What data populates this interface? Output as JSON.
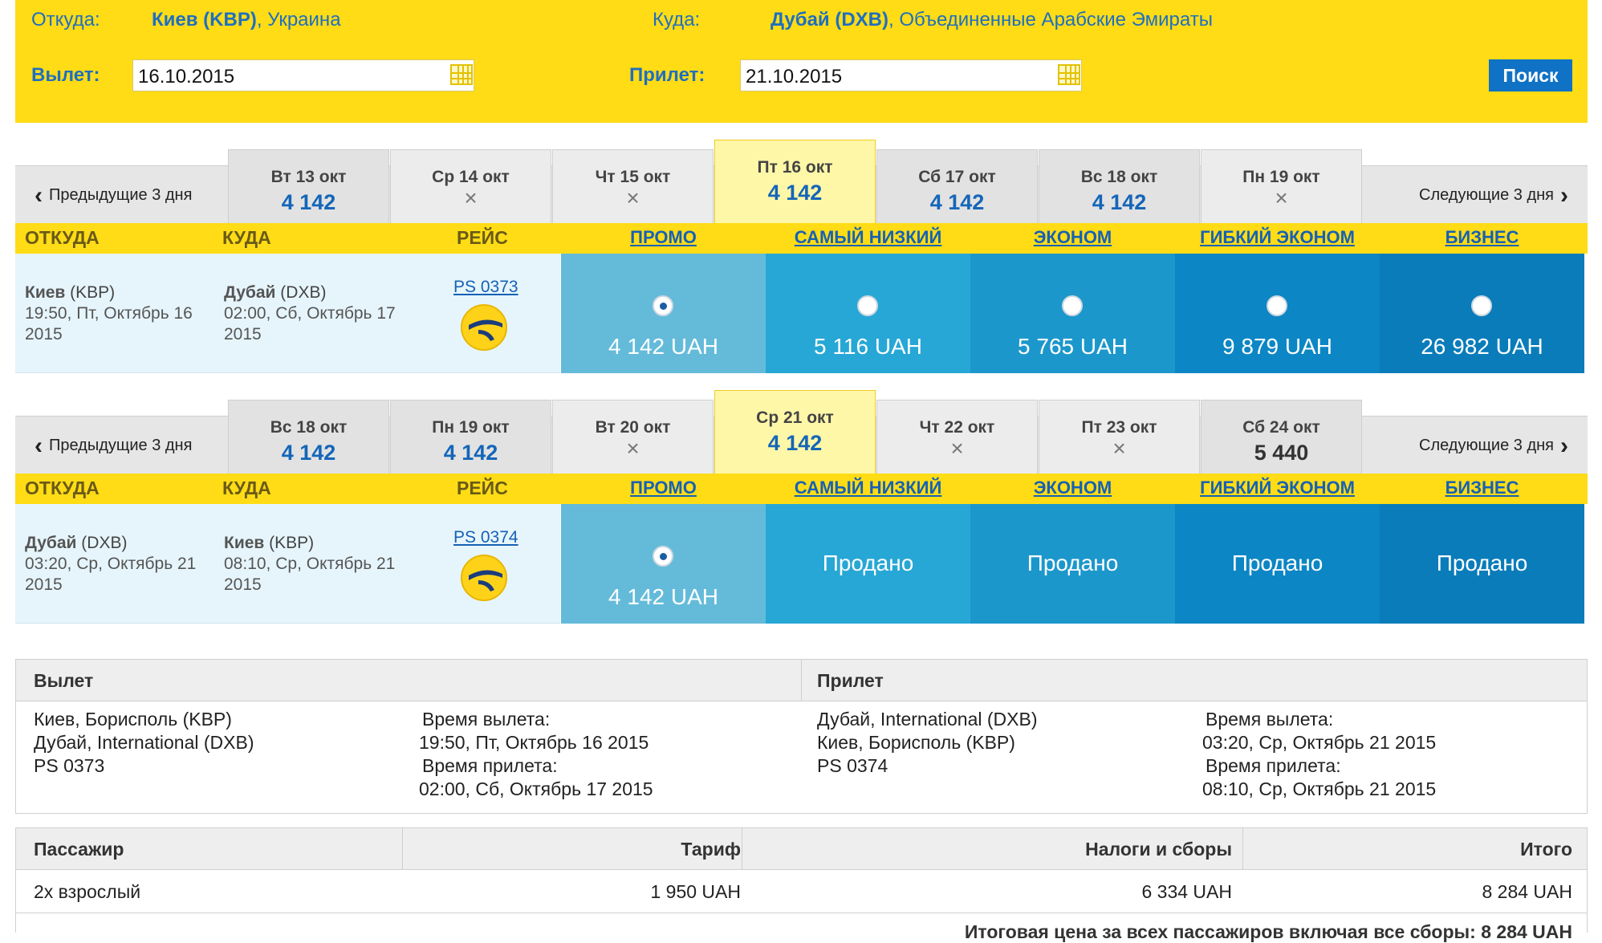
{
  "search": {
    "from_label": "Откуда:",
    "from_code": "Киев (KBP)",
    "from_country": ", Украина",
    "to_label": "Куда:",
    "to_code": "Дубай (DXB)",
    "to_country": ", Объединенные Арабские Эмираты",
    "depart_label": "Вылет:",
    "depart_value": "16.10.2015",
    "return_label": "Прилет:",
    "return_value": "21.10.2015",
    "search_button": "Поиск"
  },
  "nav": {
    "prev": "Предыдущие 3 дня",
    "next": "Следующие 3 дня"
  },
  "headers": {
    "from": "ОТКУДА",
    "to": "КУДА",
    "flight": "РЕЙС"
  },
  "fare_classes": [
    "ПРОМО",
    "САМЫЙ НИЗКИЙ",
    "ЭКОНОМ",
    "ГИБКИЙ ЭКОНОМ",
    "БИЗНЕС"
  ],
  "fare_colors": [
    "#64bbd9",
    "#27a7d5",
    "#1c97cc",
    "#0c86c4",
    "#0a7cba"
  ],
  "outbound": {
    "dates": [
      {
        "label": "Вт 13 окт",
        "price": "4 142"
      },
      {
        "label": "Ср 14 окт",
        "price": "×"
      },
      {
        "label": "Чт 15 окт",
        "price": "×"
      },
      {
        "label": "Пт 16 окт",
        "price": "4 142"
      },
      {
        "label": "Сб 17 окт",
        "price": "4 142"
      },
      {
        "label": "Вс 18 окт",
        "price": "4 142"
      },
      {
        "label": "Пн 19 окт",
        "price": "×"
      }
    ],
    "from_city": "Киев",
    "from_code": " (KBP)",
    "from_time": "19:50, Пт, Октябрь 16",
    "from_year": "2015",
    "to_city": "Дубай",
    "to_code": " (DXB)",
    "to_time": "02:00, Сб, Октябрь 17",
    "to_year": "2015",
    "flight": "PS 0373",
    "fares": [
      "4 142 UAH",
      "5 116 UAH",
      "5 765 UAH",
      "9 879 UAH",
      "26 982 UAH"
    ]
  },
  "inbound": {
    "dates": [
      {
        "label": "Вс 18 окт",
        "price": "4 142"
      },
      {
        "label": "Пн 19 окт",
        "price": "4 142"
      },
      {
        "label": "Вт 20 окт",
        "price": "×"
      },
      {
        "label": "Ср 21 окт",
        "price": "4 142"
      },
      {
        "label": "Чт 22 окт",
        "price": "×"
      },
      {
        "label": "Пт 23 окт",
        "price": "×"
      },
      {
        "label": "Сб 24 окт",
        "price": "5 440"
      }
    ],
    "from_city": "Дубай",
    "from_code": " (DXB)",
    "from_time": "03:20, Ср, Октябрь 21",
    "from_year": "2015",
    "to_city": "Киев",
    "to_code": " (KBP)",
    "to_time": "08:10, Ср, Октябрь 21",
    "to_year": "2015",
    "flight": "PS 0374",
    "fares": [
      "4 142 UAH",
      "Продано",
      "Продано",
      "Продано",
      "Продано"
    ]
  },
  "summary": {
    "depart_title": "Вылет",
    "return_title": "Прилет",
    "depart_route": [
      "Киев, Борисполь (KBP)",
      "Дубай, International (DXB)",
      "PS 0373"
    ],
    "depart_times": [
      "Время вылета:",
      "19:50, Пт, Октябрь 16 2015",
      "Время прилета:",
      "02:00, Сб, Октябрь 17 2015"
    ],
    "return_route": [
      "Дубай, International (DXB)",
      "Киев, Борисполь (KBP)",
      "PS 0374"
    ],
    "return_times": [
      "Время вылета:",
      "03:20, Ср, Октябрь 21 2015",
      "Время прилета:",
      "08:10, Ср, Октябрь 21 2015"
    ]
  },
  "prices": {
    "col_passenger": "Пассажир",
    "col_tariff": "Тариф",
    "col_taxes": "Налоги и сборы",
    "col_total": "Итого",
    "passenger": "2x взрослый",
    "tariff": "1 950 UAH",
    "taxes": "6 334 UAH",
    "total": "8 284 UAH",
    "grand_total": "Итоговая цена за всех пассажиров включая все сборы: 8 284 UAH"
  }
}
